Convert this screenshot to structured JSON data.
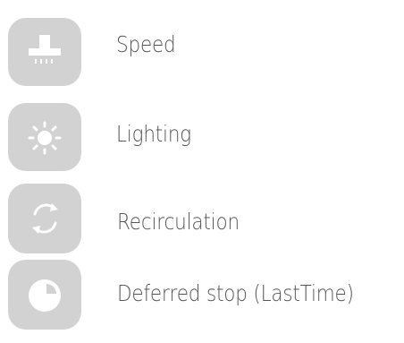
{
  "menu": {
    "items": [
      {
        "label": "Speed",
        "icon": "hood-fan-speed-icon"
      },
      {
        "label": "Lighting",
        "icon": "light-sun-icon"
      },
      {
        "label": "Recirculation",
        "icon": "recirculation-arrows-icon"
      },
      {
        "label": "Deferred stop (LastTime)",
        "icon": "timer-pie-icon"
      }
    ]
  },
  "colors": {
    "tile": "#d2d2d2",
    "icon": "#ffffff",
    "text": "#555555",
    "background": "#ffffff"
  }
}
